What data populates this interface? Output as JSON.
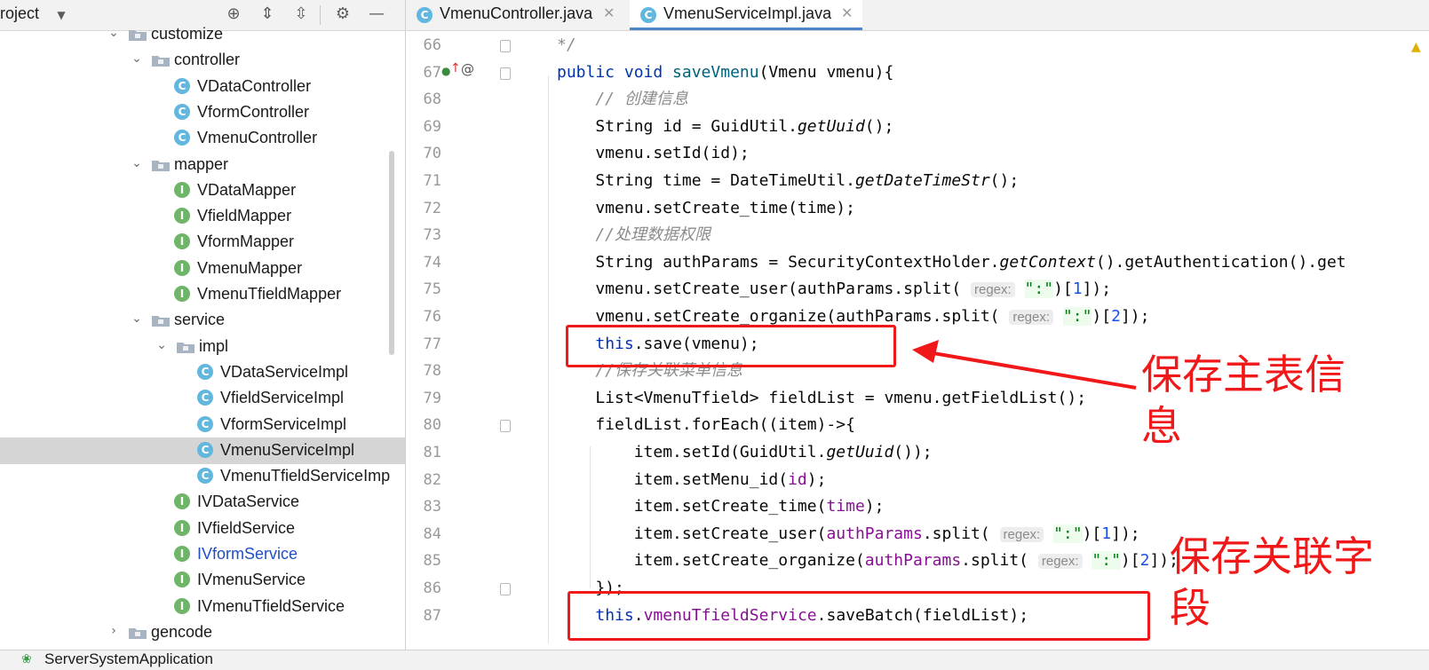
{
  "project": {
    "title": "roject",
    "tree": [
      {
        "label": "customize",
        "type": "folder",
        "expanded": true,
        "depth": 1
      },
      {
        "label": "controller",
        "type": "folder",
        "expanded": true,
        "depth": 2
      },
      {
        "label": "VDataController",
        "type": "class",
        "depth": 3
      },
      {
        "label": "VformController",
        "type": "class",
        "depth": 3
      },
      {
        "label": "VmenuController",
        "type": "class",
        "depth": 3
      },
      {
        "label": "mapper",
        "type": "folder",
        "expanded": true,
        "depth": 2
      },
      {
        "label": "VDataMapper",
        "type": "interface",
        "depth": 3
      },
      {
        "label": "VfieldMapper",
        "type": "interface",
        "depth": 3
      },
      {
        "label": "VformMapper",
        "type": "interface",
        "depth": 3
      },
      {
        "label": "VmenuMapper",
        "type": "interface",
        "depth": 3
      },
      {
        "label": "VmenuTfieldMapper",
        "type": "interface",
        "depth": 3
      },
      {
        "label": "service",
        "type": "folder",
        "expanded": true,
        "depth": 2
      },
      {
        "label": "impl",
        "type": "folder",
        "expanded": true,
        "depth": 3
      },
      {
        "label": "VDataServiceImpl",
        "type": "class",
        "depth": 4
      },
      {
        "label": "VfieldServiceImpl",
        "type": "class",
        "depth": 4
      },
      {
        "label": "VformServiceImpl",
        "type": "class",
        "depth": 4
      },
      {
        "label": "VmenuServiceImpl",
        "type": "class",
        "depth": 4,
        "selected": true
      },
      {
        "label": "VmenuTfieldServiceImp",
        "type": "class",
        "depth": 4
      },
      {
        "label": "IVDataService",
        "type": "interface",
        "depth": 3
      },
      {
        "label": "IVfieldService",
        "type": "interface",
        "depth": 3
      },
      {
        "label": "IVformService",
        "type": "interface",
        "depth": 3,
        "highlight": true
      },
      {
        "label": "IVmenuService",
        "type": "interface",
        "depth": 3
      },
      {
        "label": "IVmenuTfieldService",
        "type": "interface",
        "depth": 3
      },
      {
        "label": "gencode",
        "type": "folder",
        "expanded": false,
        "depth": 1
      }
    ]
  },
  "tabs": [
    {
      "label": "VmenuController.java",
      "active": false
    },
    {
      "label": "VmenuServiceImpl.java",
      "active": true
    }
  ],
  "icons": {
    "class": "C",
    "interface": "I",
    "close": "✕",
    "dropdown": "▼",
    "expanded": "⌄",
    "collapsed": "›",
    "locate": "⊕",
    "expand_all": "⇕",
    "collapse_all": "⇳",
    "settings": "⚙",
    "hide": "—"
  },
  "code_lines": [
    {
      "n": "66",
      "segs": [
        {
          "t": "*/",
          "c": "cm"
        }
      ]
    },
    {
      "n": "67",
      "segs": [
        {
          "t": "public void ",
          "c": "kw"
        },
        {
          "t": "saveVmenu",
          "c": "fn"
        },
        {
          "t": "(Vmenu vmenu){",
          "c": ""
        }
      ]
    },
    {
      "n": "68",
      "segs": [
        {
          "t": "    // 创建信息",
          "c": "cm"
        }
      ]
    },
    {
      "n": "69",
      "segs": [
        {
          "t": "    String id = GuidUtil.",
          "c": ""
        },
        {
          "t": "getUuid",
          "c": "it"
        },
        {
          "t": "();",
          "c": ""
        }
      ]
    },
    {
      "n": "70",
      "segs": [
        {
          "t": "    vmenu.setId(id);",
          "c": ""
        }
      ]
    },
    {
      "n": "71",
      "segs": [
        {
          "t": "    String time = DateTimeUtil.",
          "c": ""
        },
        {
          "t": "getDateTimeStr",
          "c": "it"
        },
        {
          "t": "();",
          "c": ""
        }
      ]
    },
    {
      "n": "72",
      "segs": [
        {
          "t": "    vmenu.setCreate_time(time);",
          "c": ""
        }
      ]
    },
    {
      "n": "73",
      "segs": [
        {
          "t": "    //处理数据权限",
          "c": "cm"
        }
      ]
    },
    {
      "n": "74",
      "segs": [
        {
          "t": "    String authParams = SecurityContextHolder.",
          "c": ""
        },
        {
          "t": "getContext",
          "c": "it"
        },
        {
          "t": "().getAuthentication().get",
          "c": ""
        }
      ]
    },
    {
      "n": "75",
      "segs": [
        {
          "t": "    vmenu.setCreate_user(authParams.split( ",
          "c": ""
        },
        {
          "t": "regex:",
          "c": "hint"
        },
        {
          "t": " ",
          "c": ""
        },
        {
          "t": "\":\"",
          "c": "str"
        },
        {
          "t": ")[",
          "c": ""
        },
        {
          "t": "1",
          "c": "num"
        },
        {
          "t": "]);",
          "c": ""
        }
      ]
    },
    {
      "n": "76",
      "segs": [
        {
          "t": "    vmenu.setCreate_organize(authParams.split( ",
          "c": ""
        },
        {
          "t": "regex:",
          "c": "hint"
        },
        {
          "t": " ",
          "c": ""
        },
        {
          "t": "\":\"",
          "c": "str"
        },
        {
          "t": ")[",
          "c": ""
        },
        {
          "t": "2",
          "c": "num"
        },
        {
          "t": "]);",
          "c": ""
        }
      ]
    },
    {
      "n": "77",
      "segs": [
        {
          "t": "    ",
          "c": ""
        },
        {
          "t": "this",
          "c": "kw"
        },
        {
          "t": ".save(vmenu);",
          "c": ""
        }
      ]
    },
    {
      "n": "78",
      "segs": [
        {
          "t": "    //保存关联菜单信息",
          "c": "cm"
        }
      ]
    },
    {
      "n": "79",
      "segs": [
        {
          "t": "    List<VmenuTfield> fieldList = vmenu.getFieldList();",
          "c": ""
        }
      ]
    },
    {
      "n": "80",
      "segs": [
        {
          "t": "    fieldList.forEach((item)->{",
          "c": ""
        }
      ]
    },
    {
      "n": "81",
      "segs": [
        {
          "t": "        item.setId(GuidUtil.",
          "c": ""
        },
        {
          "t": "getUuid",
          "c": "it"
        },
        {
          "t": "());",
          "c": ""
        }
      ]
    },
    {
      "n": "82",
      "segs": [
        {
          "t": "        item.setMenu_id(",
          "c": ""
        },
        {
          "t": "id",
          "c": "fld"
        },
        {
          "t": ");",
          "c": ""
        }
      ]
    },
    {
      "n": "83",
      "segs": [
        {
          "t": "        item.setCreate_time(",
          "c": ""
        },
        {
          "t": "time",
          "c": "fld"
        },
        {
          "t": ");",
          "c": ""
        }
      ]
    },
    {
      "n": "84",
      "segs": [
        {
          "t": "        item.setCreate_user(",
          "c": ""
        },
        {
          "t": "authParams",
          "c": "fld"
        },
        {
          "t": ".split( ",
          "c": ""
        },
        {
          "t": "regex:",
          "c": "hint"
        },
        {
          "t": " ",
          "c": ""
        },
        {
          "t": "\":\"",
          "c": "str"
        },
        {
          "t": ")[",
          "c": ""
        },
        {
          "t": "1",
          "c": "num"
        },
        {
          "t": "]);",
          "c": ""
        }
      ]
    },
    {
      "n": "85",
      "segs": [
        {
          "t": "        item.setCreate_organize(",
          "c": ""
        },
        {
          "t": "authParams",
          "c": "fld"
        },
        {
          "t": ".split( ",
          "c": ""
        },
        {
          "t": "regex:",
          "c": "hint"
        },
        {
          "t": " ",
          "c": ""
        },
        {
          "t": "\":\"",
          "c": "str"
        },
        {
          "t": ")[",
          "c": ""
        },
        {
          "t": "2",
          "c": "num"
        },
        {
          "t": "]);",
          "c": ""
        }
      ]
    },
    {
      "n": "86",
      "segs": [
        {
          "t": "    });",
          "c": ""
        }
      ]
    },
    {
      "n": "87",
      "segs": [
        {
          "t": "    ",
          "c": ""
        },
        {
          "t": "this",
          "c": "kw"
        },
        {
          "t": ".",
          "c": ""
        },
        {
          "t": "vmenuTfieldService",
          "c": "fld"
        },
        {
          "t": ".saveBatch(fieldList);",
          "c": ""
        }
      ]
    }
  ],
  "annotations": {
    "save_main": "保存主表信\n息",
    "save_fields": "保存关联字\n段"
  },
  "bottom_bar": {
    "run_config": "ServerSystemApplication"
  },
  "colors": {
    "annotation": "#f01818",
    "accent_tab": "#4a86c8",
    "keyword": "#0033b3"
  }
}
